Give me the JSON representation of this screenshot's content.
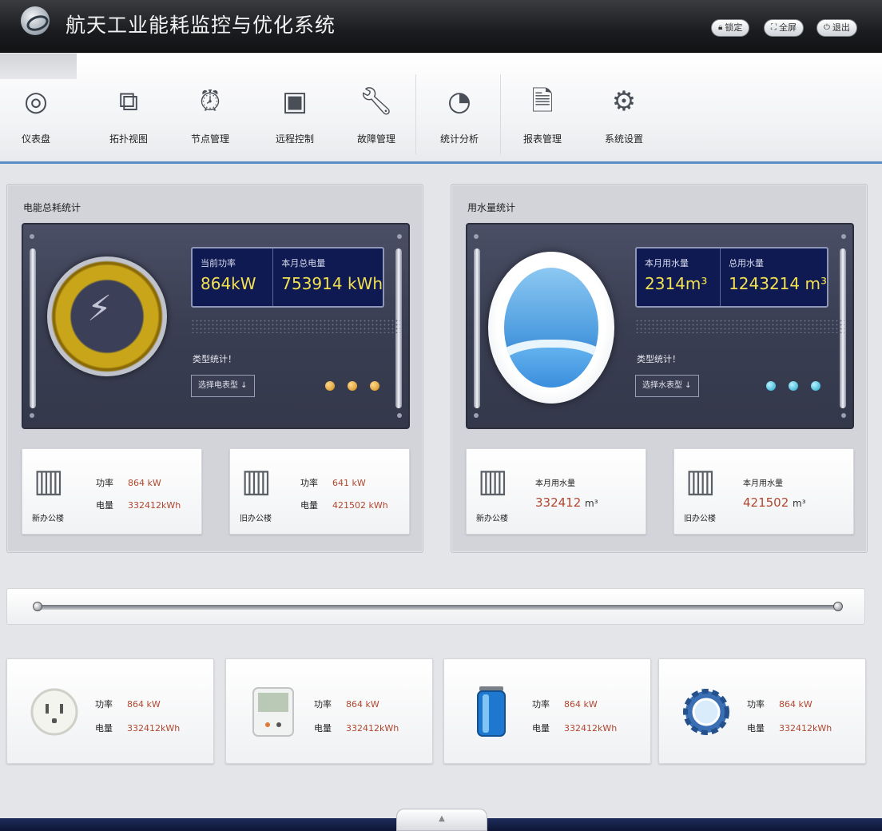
{
  "header": {
    "title": "航天工业能耗监控与优化系统",
    "buttons": [
      {
        "label": "锁定",
        "icon": "lock-icon"
      },
      {
        "label": "全屏",
        "icon": "fullscreen-icon"
      },
      {
        "label": "退出",
        "icon": "power-icon"
      }
    ]
  },
  "toolbar": {
    "items": [
      {
        "label": "仪表盘",
        "icon": "gauge-icon"
      },
      {
        "label": "拓扑视图",
        "icon": "topology-icon"
      },
      {
        "label": "节点管理",
        "icon": "alarm-clock-icon"
      },
      {
        "label": "远程控制",
        "icon": "monitor-icon"
      },
      {
        "label": "故障管理",
        "icon": "wrench-icon"
      },
      {
        "label": "统计分析",
        "icon": "pie-chart-icon"
      },
      {
        "label": "报表管理",
        "icon": "document-icon"
      },
      {
        "label": "系统设置",
        "icon": "gear-icon"
      }
    ]
  },
  "electric": {
    "title": "电能总耗统计",
    "readout": {
      "cap1": "当前功率",
      "val1": "864kW",
      "cap2": "本月总电量",
      "val2": "753914 kWh"
    },
    "type_label": "类型统计！",
    "type_select": "选择电表型 ↓",
    "cards": [
      {
        "name": "新办公楼",
        "power_cap": "功率",
        "power": "864 kW",
        "energy_cap": "电量",
        "energy": "332412kWh"
      },
      {
        "name": "旧办公楼",
        "power_cap": "功率",
        "power": "641 kW",
        "energy_cap": "电量",
        "energy": "421502 kWh"
      }
    ]
  },
  "water": {
    "title": "用水量统计",
    "readout": {
      "cap1": "本月用水量",
      "val1": "2314m³",
      "cap2": "总用水量",
      "val2": "1243214 m³"
    },
    "type_label": "类型统计！",
    "type_select": "选择水表型 ↓",
    "cards": [
      {
        "name": "新办公楼",
        "cap": "本月用水量",
        "value": "332412",
        "unit": "m³"
      },
      {
        "name": "旧办公楼",
        "cap": "本月用水量",
        "value": "421502",
        "unit": "m³"
      }
    ]
  },
  "devices": [
    {
      "icon": "power-socket-icon",
      "power_cap": "功率",
      "power": "864 kW",
      "energy_cap": "电量",
      "energy": "332412kWh"
    },
    {
      "icon": "thermostat-icon",
      "power_cap": "功率",
      "power": "864 kW",
      "energy_cap": "电量",
      "energy": "332412kWh"
    },
    {
      "icon": "battery-icon",
      "power_cap": "功率",
      "power": "864 kW",
      "energy_cap": "电量",
      "energy": "332412kWh"
    },
    {
      "icon": "gear-device-icon",
      "power_cap": "功率",
      "power": "864 kW",
      "energy_cap": "电量",
      "energy": "332412kWh"
    }
  ],
  "colors": {
    "accent_blue": "#5b8ec4",
    "readout_value": "#f2e050",
    "card_value": "#b0472f"
  }
}
